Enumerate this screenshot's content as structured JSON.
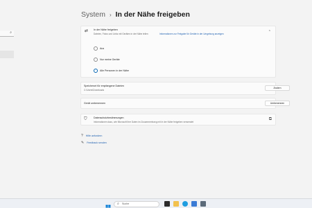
{
  "sidebar": {
    "search_icon": "search-icon"
  },
  "breadcrumb": {
    "parent": "System",
    "separator": "›",
    "current": "In der Nähe freigeben"
  },
  "nearby": {
    "title": "In der Nähe freigeben",
    "description": "Dateien, Fotos und Links mit Geräten in der Nähe teilen",
    "link": "Informationen zur Freigabe für Geräte in der Umgebung anzeigen",
    "options": [
      {
        "label": "Aus",
        "selected": false
      },
      {
        "label": "Nur meine Geräte",
        "selected": false
      },
      {
        "label": "Alle Personen in der Nähe",
        "selected": true
      }
    ]
  },
  "save_location": {
    "title": "Speicherort für empfangene Dateien",
    "path": "C:\\Users\\Downloads",
    "button": "Ändern"
  },
  "rename": {
    "title": "Gerät umbenennen",
    "button": "Umbenennen"
  },
  "privacy": {
    "title": "Datenschutzbestimmungen",
    "description": "Informationen dazu, wie Microsoft Ihre Daten im Zusammenhang mit In der Nähe freigeben verwendet"
  },
  "help": {
    "get_help": "Hilfe anfordern",
    "feedback": "Feedback senden"
  },
  "taskbar": {
    "search_placeholder": "Suche"
  },
  "colors": {
    "accent": "#0063b1",
    "link": "#1d5fb0",
    "background": "#f3f3f3"
  }
}
